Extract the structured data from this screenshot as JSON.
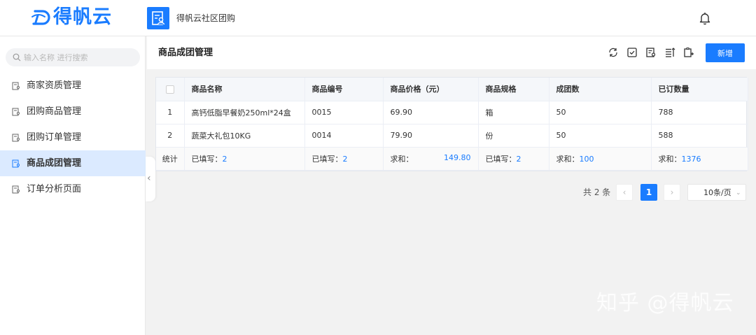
{
  "header": {
    "logo_text": "得帆云",
    "app_title": "得帆云社区团购"
  },
  "sidebar": {
    "search_placeholder": "输入名称 进行搜索",
    "items": [
      {
        "label": "商家资质管理"
      },
      {
        "label": "团购商品管理"
      },
      {
        "label": "团购订单管理"
      },
      {
        "label": "商品成团管理",
        "active": true
      },
      {
        "label": "订单分析页面"
      }
    ]
  },
  "main": {
    "page_title": "商品成团管理",
    "new_button": "新增",
    "table": {
      "columns": [
        "商品名称",
        "商品编号",
        "商品价格（元）",
        "商品规格",
        "成团数",
        "已订数量"
      ],
      "rows": [
        {
          "index": "1",
          "name": "高钙低脂早餐奶250ml*24盒",
          "code": "0015",
          "price": "69.90",
          "spec": "箱",
          "group_count": "50",
          "ordered": "788"
        },
        {
          "index": "2",
          "name": "蔬菜大礼包10KG",
          "code": "0014",
          "price": "79.90",
          "spec": "份",
          "group_count": "50",
          "ordered": "588"
        }
      ],
      "summary": {
        "label": "统计",
        "name": {
          "prefix": "已填写：",
          "value": "2"
        },
        "code": {
          "prefix": "已填写：",
          "value": "2"
        },
        "price": {
          "prefix": "求和：",
          "value": "149.80"
        },
        "spec": {
          "prefix": "已填写：",
          "value": "2"
        },
        "group_count": {
          "prefix": "求和：",
          "value": "100"
        },
        "ordered": {
          "prefix": "求和：",
          "value": "1376"
        }
      }
    },
    "pagination": {
      "total": "共 2 条",
      "prev": "‹",
      "current": "1",
      "next": "›",
      "page_size": "10条/页",
      "caret": "⌄"
    }
  },
  "watermark": "知乎 @得帆云",
  "colors": {
    "accent": "#1a7cff",
    "active_bg": "#dbeaff"
  }
}
